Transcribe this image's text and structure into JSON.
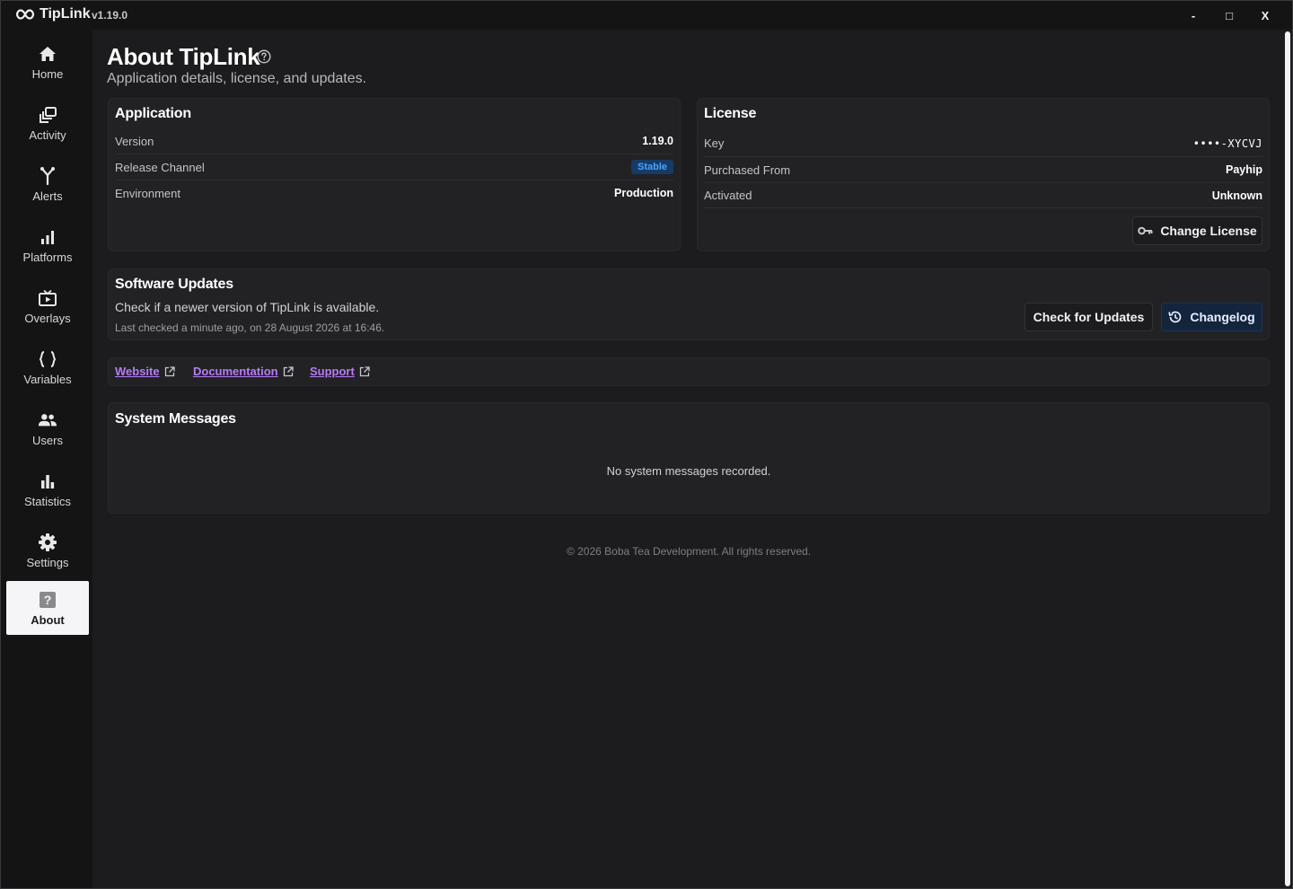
{
  "titlebar": {
    "app_name": "TipLink",
    "version": "v1.19.0",
    "minimize_glyph": "-",
    "maximize_glyph": "□",
    "close_glyph": "X"
  },
  "sidebar": {
    "items": [
      {
        "label": "Home",
        "icon": "home-icon"
      },
      {
        "label": "Activity",
        "icon": "activity-icon"
      },
      {
        "label": "Alerts",
        "icon": "alerts-icon"
      },
      {
        "label": "Platforms",
        "icon": "platforms-icon"
      },
      {
        "label": "Overlays",
        "icon": "overlays-icon"
      },
      {
        "label": "Variables",
        "icon": "variables-icon"
      },
      {
        "label": "Users",
        "icon": "users-icon"
      },
      {
        "label": "Statistics",
        "icon": "statistics-icon"
      },
      {
        "label": "Settings",
        "icon": "settings-icon"
      },
      {
        "label": "About",
        "icon": "help-icon",
        "active": true
      }
    ]
  },
  "page": {
    "title": "About TipLink",
    "subtitle": "Application details, license, and updates."
  },
  "application": {
    "title": "Application",
    "rows": [
      {
        "key": "Version",
        "value": "1.19.0"
      },
      {
        "key": "Release Channel",
        "value": "Stable"
      },
      {
        "key": "Environment",
        "value": "Production"
      }
    ]
  },
  "license": {
    "title": "License",
    "rows": [
      {
        "key": "Key",
        "value": "••••-XYCVJ"
      },
      {
        "key": "Purchased From",
        "value": "Payhip"
      },
      {
        "key": "Activated",
        "value": "Unknown"
      }
    ],
    "change_button": "Change License"
  },
  "updates": {
    "title": "Software Updates",
    "description": "Check if a newer version of TipLink is available.",
    "last_checked": "Last checked a minute ago, on 28 August 2026 at 16:46.",
    "check_button": "Check for Updates",
    "changelog_button": "Changelog"
  },
  "links": [
    {
      "label": "Website"
    },
    {
      "label": "Documentation"
    },
    {
      "label": "Support"
    }
  ],
  "messages": {
    "title": "System Messages",
    "empty": "No system messages recorded."
  },
  "footer": "© 2026 Boba Tea Development. All rights reserved.",
  "colors": {
    "background": "#1c1c1e",
    "sidebar": "#141415",
    "card": "#222224",
    "link": "#b67cf5",
    "badge_text": "#4aa3ff",
    "primary_button": "#13243d"
  }
}
